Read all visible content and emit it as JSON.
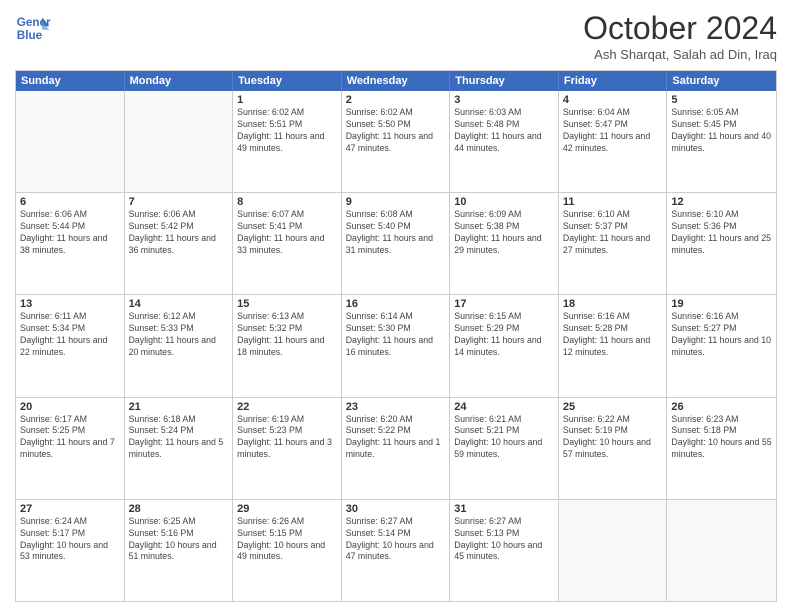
{
  "header": {
    "logo_line1": "General",
    "logo_line2": "Blue",
    "month_title": "October 2024",
    "subtitle": "Ash Sharqat, Salah ad Din, Iraq"
  },
  "calendar": {
    "days_of_week": [
      "Sunday",
      "Monday",
      "Tuesday",
      "Wednesday",
      "Thursday",
      "Friday",
      "Saturday"
    ],
    "weeks": [
      [
        {
          "day": "",
          "info": ""
        },
        {
          "day": "",
          "info": ""
        },
        {
          "day": "1",
          "info": "Sunrise: 6:02 AM\nSunset: 5:51 PM\nDaylight: 11 hours and 49 minutes."
        },
        {
          "day": "2",
          "info": "Sunrise: 6:02 AM\nSunset: 5:50 PM\nDaylight: 11 hours and 47 minutes."
        },
        {
          "day": "3",
          "info": "Sunrise: 6:03 AM\nSunset: 5:48 PM\nDaylight: 11 hours and 44 minutes."
        },
        {
          "day": "4",
          "info": "Sunrise: 6:04 AM\nSunset: 5:47 PM\nDaylight: 11 hours and 42 minutes."
        },
        {
          "day": "5",
          "info": "Sunrise: 6:05 AM\nSunset: 5:45 PM\nDaylight: 11 hours and 40 minutes."
        }
      ],
      [
        {
          "day": "6",
          "info": "Sunrise: 6:06 AM\nSunset: 5:44 PM\nDaylight: 11 hours and 38 minutes."
        },
        {
          "day": "7",
          "info": "Sunrise: 6:06 AM\nSunset: 5:42 PM\nDaylight: 11 hours and 36 minutes."
        },
        {
          "day": "8",
          "info": "Sunrise: 6:07 AM\nSunset: 5:41 PM\nDaylight: 11 hours and 33 minutes."
        },
        {
          "day": "9",
          "info": "Sunrise: 6:08 AM\nSunset: 5:40 PM\nDaylight: 11 hours and 31 minutes."
        },
        {
          "day": "10",
          "info": "Sunrise: 6:09 AM\nSunset: 5:38 PM\nDaylight: 11 hours and 29 minutes."
        },
        {
          "day": "11",
          "info": "Sunrise: 6:10 AM\nSunset: 5:37 PM\nDaylight: 11 hours and 27 minutes."
        },
        {
          "day": "12",
          "info": "Sunrise: 6:10 AM\nSunset: 5:36 PM\nDaylight: 11 hours and 25 minutes."
        }
      ],
      [
        {
          "day": "13",
          "info": "Sunrise: 6:11 AM\nSunset: 5:34 PM\nDaylight: 11 hours and 22 minutes."
        },
        {
          "day": "14",
          "info": "Sunrise: 6:12 AM\nSunset: 5:33 PM\nDaylight: 11 hours and 20 minutes."
        },
        {
          "day": "15",
          "info": "Sunrise: 6:13 AM\nSunset: 5:32 PM\nDaylight: 11 hours and 18 minutes."
        },
        {
          "day": "16",
          "info": "Sunrise: 6:14 AM\nSunset: 5:30 PM\nDaylight: 11 hours and 16 minutes."
        },
        {
          "day": "17",
          "info": "Sunrise: 6:15 AM\nSunset: 5:29 PM\nDaylight: 11 hours and 14 minutes."
        },
        {
          "day": "18",
          "info": "Sunrise: 6:16 AM\nSunset: 5:28 PM\nDaylight: 11 hours and 12 minutes."
        },
        {
          "day": "19",
          "info": "Sunrise: 6:16 AM\nSunset: 5:27 PM\nDaylight: 11 hours and 10 minutes."
        }
      ],
      [
        {
          "day": "20",
          "info": "Sunrise: 6:17 AM\nSunset: 5:25 PM\nDaylight: 11 hours and 7 minutes."
        },
        {
          "day": "21",
          "info": "Sunrise: 6:18 AM\nSunset: 5:24 PM\nDaylight: 11 hours and 5 minutes."
        },
        {
          "day": "22",
          "info": "Sunrise: 6:19 AM\nSunset: 5:23 PM\nDaylight: 11 hours and 3 minutes."
        },
        {
          "day": "23",
          "info": "Sunrise: 6:20 AM\nSunset: 5:22 PM\nDaylight: 11 hours and 1 minute."
        },
        {
          "day": "24",
          "info": "Sunrise: 6:21 AM\nSunset: 5:21 PM\nDaylight: 10 hours and 59 minutes."
        },
        {
          "day": "25",
          "info": "Sunrise: 6:22 AM\nSunset: 5:19 PM\nDaylight: 10 hours and 57 minutes."
        },
        {
          "day": "26",
          "info": "Sunrise: 6:23 AM\nSunset: 5:18 PM\nDaylight: 10 hours and 55 minutes."
        }
      ],
      [
        {
          "day": "27",
          "info": "Sunrise: 6:24 AM\nSunset: 5:17 PM\nDaylight: 10 hours and 53 minutes."
        },
        {
          "day": "28",
          "info": "Sunrise: 6:25 AM\nSunset: 5:16 PM\nDaylight: 10 hours and 51 minutes."
        },
        {
          "day": "29",
          "info": "Sunrise: 6:26 AM\nSunset: 5:15 PM\nDaylight: 10 hours and 49 minutes."
        },
        {
          "day": "30",
          "info": "Sunrise: 6:27 AM\nSunset: 5:14 PM\nDaylight: 10 hours and 47 minutes."
        },
        {
          "day": "31",
          "info": "Sunrise: 6:27 AM\nSunset: 5:13 PM\nDaylight: 10 hours and 45 minutes."
        },
        {
          "day": "",
          "info": ""
        },
        {
          "day": "",
          "info": ""
        }
      ]
    ]
  }
}
